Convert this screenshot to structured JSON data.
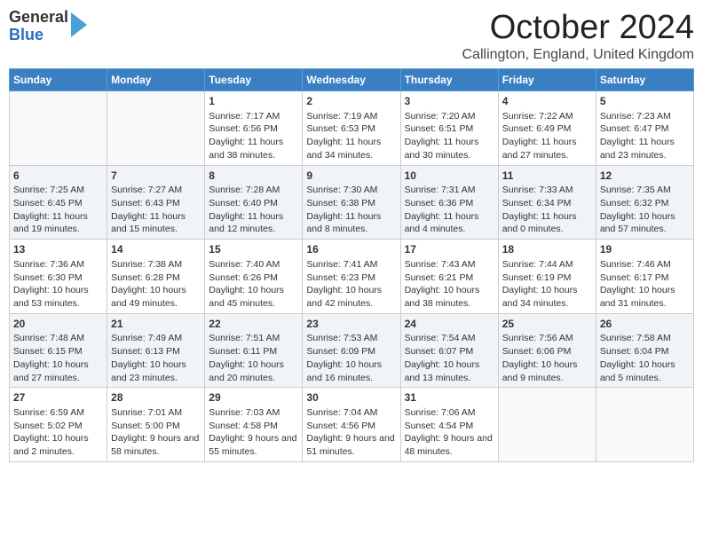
{
  "header": {
    "logo_line1": "General",
    "logo_line2": "Blue",
    "month_title": "October 2024",
    "location": "Callington, England, United Kingdom"
  },
  "days_of_week": [
    "Sunday",
    "Monday",
    "Tuesday",
    "Wednesday",
    "Thursday",
    "Friday",
    "Saturday"
  ],
  "weeks": [
    [
      {
        "num": "",
        "info": ""
      },
      {
        "num": "",
        "info": ""
      },
      {
        "num": "1",
        "info": "Sunrise: 7:17 AM\nSunset: 6:56 PM\nDaylight: 11 hours and 38 minutes."
      },
      {
        "num": "2",
        "info": "Sunrise: 7:19 AM\nSunset: 6:53 PM\nDaylight: 11 hours and 34 minutes."
      },
      {
        "num": "3",
        "info": "Sunrise: 7:20 AM\nSunset: 6:51 PM\nDaylight: 11 hours and 30 minutes."
      },
      {
        "num": "4",
        "info": "Sunrise: 7:22 AM\nSunset: 6:49 PM\nDaylight: 11 hours and 27 minutes."
      },
      {
        "num": "5",
        "info": "Sunrise: 7:23 AM\nSunset: 6:47 PM\nDaylight: 11 hours and 23 minutes."
      }
    ],
    [
      {
        "num": "6",
        "info": "Sunrise: 7:25 AM\nSunset: 6:45 PM\nDaylight: 11 hours and 19 minutes."
      },
      {
        "num": "7",
        "info": "Sunrise: 7:27 AM\nSunset: 6:43 PM\nDaylight: 11 hours and 15 minutes."
      },
      {
        "num": "8",
        "info": "Sunrise: 7:28 AM\nSunset: 6:40 PM\nDaylight: 11 hours and 12 minutes."
      },
      {
        "num": "9",
        "info": "Sunrise: 7:30 AM\nSunset: 6:38 PM\nDaylight: 11 hours and 8 minutes."
      },
      {
        "num": "10",
        "info": "Sunrise: 7:31 AM\nSunset: 6:36 PM\nDaylight: 11 hours and 4 minutes."
      },
      {
        "num": "11",
        "info": "Sunrise: 7:33 AM\nSunset: 6:34 PM\nDaylight: 11 hours and 0 minutes."
      },
      {
        "num": "12",
        "info": "Sunrise: 7:35 AM\nSunset: 6:32 PM\nDaylight: 10 hours and 57 minutes."
      }
    ],
    [
      {
        "num": "13",
        "info": "Sunrise: 7:36 AM\nSunset: 6:30 PM\nDaylight: 10 hours and 53 minutes."
      },
      {
        "num": "14",
        "info": "Sunrise: 7:38 AM\nSunset: 6:28 PM\nDaylight: 10 hours and 49 minutes."
      },
      {
        "num": "15",
        "info": "Sunrise: 7:40 AM\nSunset: 6:26 PM\nDaylight: 10 hours and 45 minutes."
      },
      {
        "num": "16",
        "info": "Sunrise: 7:41 AM\nSunset: 6:23 PM\nDaylight: 10 hours and 42 minutes."
      },
      {
        "num": "17",
        "info": "Sunrise: 7:43 AM\nSunset: 6:21 PM\nDaylight: 10 hours and 38 minutes."
      },
      {
        "num": "18",
        "info": "Sunrise: 7:44 AM\nSunset: 6:19 PM\nDaylight: 10 hours and 34 minutes."
      },
      {
        "num": "19",
        "info": "Sunrise: 7:46 AM\nSunset: 6:17 PM\nDaylight: 10 hours and 31 minutes."
      }
    ],
    [
      {
        "num": "20",
        "info": "Sunrise: 7:48 AM\nSunset: 6:15 PM\nDaylight: 10 hours and 27 minutes."
      },
      {
        "num": "21",
        "info": "Sunrise: 7:49 AM\nSunset: 6:13 PM\nDaylight: 10 hours and 23 minutes."
      },
      {
        "num": "22",
        "info": "Sunrise: 7:51 AM\nSunset: 6:11 PM\nDaylight: 10 hours and 20 minutes."
      },
      {
        "num": "23",
        "info": "Sunrise: 7:53 AM\nSunset: 6:09 PM\nDaylight: 10 hours and 16 minutes."
      },
      {
        "num": "24",
        "info": "Sunrise: 7:54 AM\nSunset: 6:07 PM\nDaylight: 10 hours and 13 minutes."
      },
      {
        "num": "25",
        "info": "Sunrise: 7:56 AM\nSunset: 6:06 PM\nDaylight: 10 hours and 9 minutes."
      },
      {
        "num": "26",
        "info": "Sunrise: 7:58 AM\nSunset: 6:04 PM\nDaylight: 10 hours and 5 minutes."
      }
    ],
    [
      {
        "num": "27",
        "info": "Sunrise: 6:59 AM\nSunset: 5:02 PM\nDaylight: 10 hours and 2 minutes."
      },
      {
        "num": "28",
        "info": "Sunrise: 7:01 AM\nSunset: 5:00 PM\nDaylight: 9 hours and 58 minutes."
      },
      {
        "num": "29",
        "info": "Sunrise: 7:03 AM\nSunset: 4:58 PM\nDaylight: 9 hours and 55 minutes."
      },
      {
        "num": "30",
        "info": "Sunrise: 7:04 AM\nSunset: 4:56 PM\nDaylight: 9 hours and 51 minutes."
      },
      {
        "num": "31",
        "info": "Sunrise: 7:06 AM\nSunset: 4:54 PM\nDaylight: 9 hours and 48 minutes."
      },
      {
        "num": "",
        "info": ""
      },
      {
        "num": "",
        "info": ""
      }
    ]
  ]
}
